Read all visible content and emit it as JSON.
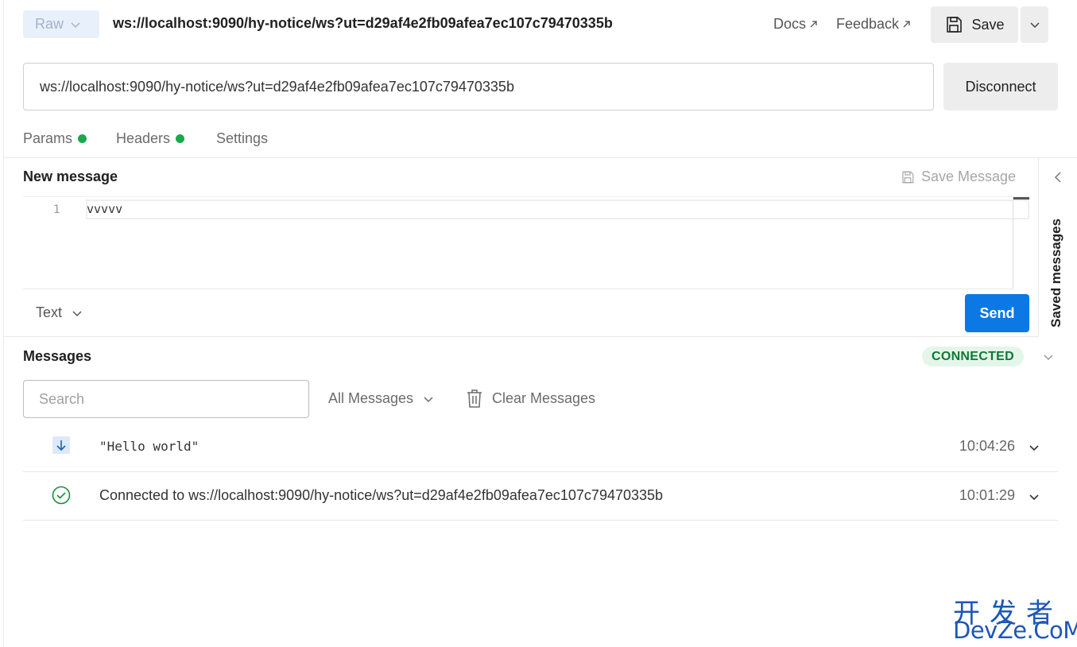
{
  "top_bar": {
    "mode_label": "Raw",
    "request_title": "ws://localhost:9090/hy-notice/ws?ut=d29af4e2fb09afea7ec107c79470335b",
    "docs_label": "Docs",
    "feedback_label": "Feedback",
    "save_label": "Save"
  },
  "url_bar": {
    "url_value": "ws://localhost:9090/hy-notice/ws?ut=d29af4e2fb09afea7ec107c79470335b",
    "disconnect_label": "Disconnect"
  },
  "tabs": [
    {
      "label": "Params",
      "has_indicator": true
    },
    {
      "label": "Headers",
      "has_indicator": true
    },
    {
      "label": "Settings",
      "has_indicator": false
    }
  ],
  "new_message": {
    "title": "New message",
    "save_message_label": "Save Message",
    "line_number": "1",
    "content": "vvvvv",
    "format_label": "Text",
    "send_label": "Send"
  },
  "saved_messages": {
    "label": "Saved messages"
  },
  "messages": {
    "title": "Messages",
    "status": "CONNECTED",
    "search_placeholder": "Search",
    "filter_label": "All Messages",
    "clear_label": "Clear Messages",
    "items": [
      {
        "type": "incoming",
        "text": "\"Hello world\"",
        "time": "10:04:26"
      },
      {
        "type": "connected",
        "text": "Connected to ws://localhost:9090/hy-notice/ws?ut=d29af4e2fb09afea7ec107c79470335b",
        "time": "10:01:29"
      }
    ]
  },
  "watermark": {
    "line1": "开发者",
    "line2": "DevZe.CoM"
  },
  "colors": {
    "accent": "#0b78e3",
    "connected_bg": "#e4f6e9",
    "connected_text": "#0d7a33",
    "indicator_dot": "#1aa84c",
    "watermark": "#1d57b5"
  }
}
